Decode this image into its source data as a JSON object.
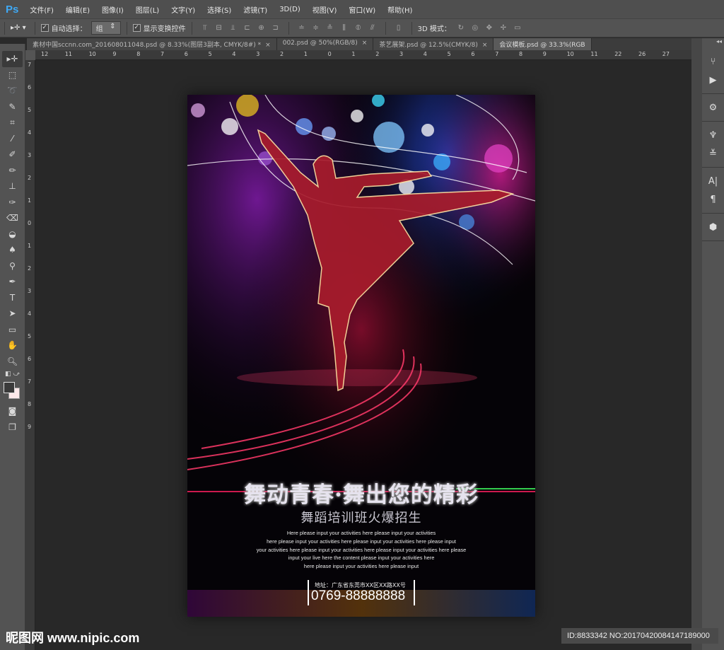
{
  "app": {
    "logo": "Ps"
  },
  "menu": [
    "文件(F)",
    "编辑(E)",
    "图像(I)",
    "图层(L)",
    "文字(Y)",
    "选择(S)",
    "滤镜(T)",
    "3D(D)",
    "视图(V)",
    "窗口(W)",
    "帮助(H)"
  ],
  "options": {
    "auto_select_label": "自动选择：",
    "auto_select_value": "组",
    "show_transform_label": "显示变换控件",
    "mode_3d_label": "3D 模式："
  },
  "tabs": [
    {
      "label": "素材中国sccnn.com_201608011048.psd @ 8.33%(图层3副本, CMYK/8#) *",
      "active": false
    },
    {
      "label": "002.psd @ 50%(RGB/8)",
      "active": false
    },
    {
      "label": "茶艺展架.psd @ 12.5%(CMYK/8)",
      "active": false
    },
    {
      "label": "会议模板.psd @ 33.3%(RGB",
      "active": true
    }
  ],
  "hruler": [
    "12",
    "11",
    "10",
    "9",
    "8",
    "7",
    "6",
    "5",
    "4",
    "3",
    "2",
    "1",
    "0",
    "1",
    "2",
    "3",
    "4",
    "5",
    "6",
    "7",
    "8",
    "9",
    "10",
    "11",
    "22",
    "26",
    "27"
  ],
  "vruler": [
    "7",
    "6",
    "5",
    "4",
    "3",
    "2",
    "1",
    "0",
    "1",
    "2",
    "3",
    "4",
    "5",
    "6",
    "7",
    "8",
    "9"
  ],
  "poster": {
    "title": "舞动青春·舞出您的精彩",
    "subtitle": "舞蹈培训班火爆招生",
    "body": [
      "Here please input your activities here please input your activities",
      "here please input your activities here please input your activities here please input",
      "your activities here please input your activities here please input your activities here please",
      "input your live here the content please input your activities here",
      "here please input your activities here please input"
    ],
    "address": "地址：广东省东莞市XX区XX路XX号",
    "phone": "0769-88888888"
  },
  "watermark": "昵图网 www.nipic.com",
  "image_id": "ID:8833342 NO:20170420084147189000"
}
